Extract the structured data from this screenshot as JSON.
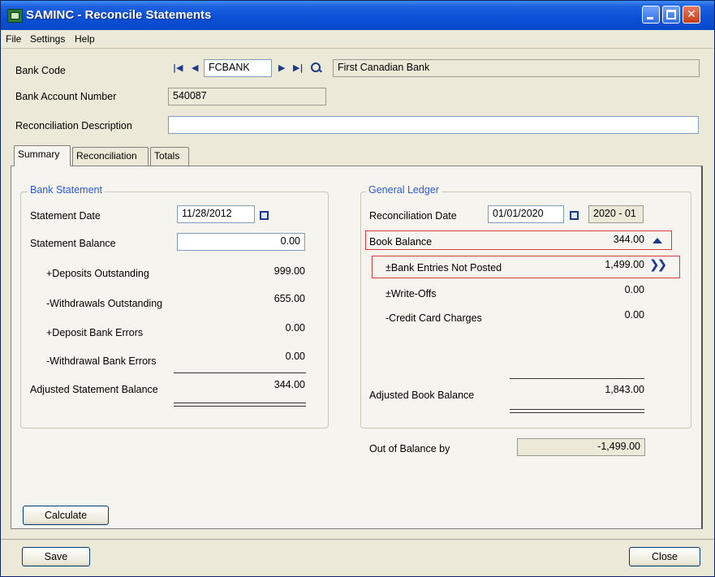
{
  "window": {
    "title": "SAMINC - Reconcile Statements",
    "icons": [
      "app-icon",
      "minimize-icon",
      "maximize-icon",
      "close-icon"
    ]
  },
  "menu": {
    "file": "File",
    "settings": "Settings",
    "help": "Help"
  },
  "header": {
    "bank_code_label": "Bank Code",
    "bank_code_value": "FCBANK",
    "bank_name": "First Canadian Bank",
    "account_number_label": "Bank Account Number",
    "account_number_value": "540087",
    "description_label": "Reconciliation Description",
    "description_value": ""
  },
  "tabs": [
    {
      "label": "Summary",
      "active": true
    },
    {
      "label": "Reconciliation",
      "active": false
    },
    {
      "label": "Totals",
      "active": false
    }
  ],
  "bank_statement": {
    "title": "Bank Statement",
    "statement_date_label": "Statement Date",
    "statement_date": "11/28/2012",
    "statement_balance_label": "Statement Balance",
    "statement_balance": "0.00",
    "deposits_outstanding_label": "+Deposits Outstanding",
    "deposits_outstanding": "999.00",
    "withdrawals_outstanding_label": "-Withdrawals Outstanding",
    "withdrawals_outstanding": "655.00",
    "deposit_bank_errors_label": "+Deposit Bank Errors",
    "deposit_bank_errors": "0.00",
    "withdrawal_bank_errors_label": "-Withdrawal Bank Errors",
    "withdrawal_bank_errors": "0.00",
    "adjusted_statement_balance_label": "Adjusted Statement Balance",
    "adjusted_statement_balance": "344.00"
  },
  "general_ledger": {
    "title": "General Ledger",
    "reconciliation_date_label": "Reconciliation Date",
    "reconciliation_date": "01/01/2020",
    "period": "2020 - 01",
    "book_balance_label": "Book Balance",
    "book_balance": "344.00",
    "bank_entries_not_posted_label": "±Bank Entries Not Posted",
    "bank_entries_not_posted": "1,499.00",
    "write_offs_label": "±Write-Offs",
    "write_offs": "0.00",
    "credit_card_charges_label": "-Credit Card Charges",
    "credit_card_charges": "0.00",
    "adjusted_book_balance_label": "Adjusted Book Balance",
    "adjusted_book_balance": "1,843.00",
    "out_of_balance_label": "Out of Balance by",
    "out_of_balance": "-1,499.00"
  },
  "buttons": {
    "calculate": "Calculate",
    "save": "Save",
    "close": "Close"
  },
  "colors": {
    "titlebar": "#0a4fd6",
    "group_title": "#2c5ad1",
    "highlight": "#d93b3b",
    "window_bg": "#ece9d8"
  }
}
